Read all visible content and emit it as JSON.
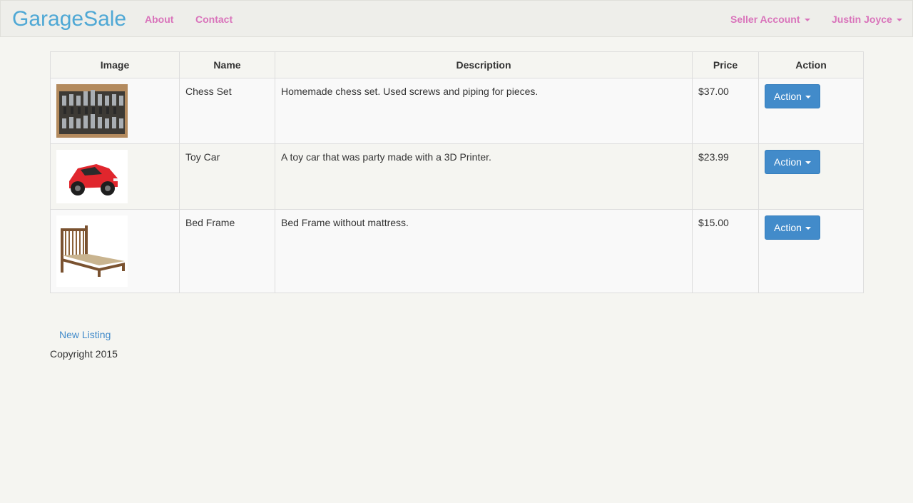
{
  "nav": {
    "brand": "GarageSale",
    "about": "About",
    "contact": "Contact",
    "seller_account": "Seller Account",
    "user": "Justin Joyce"
  },
  "table": {
    "headers": [
      "Image",
      "Name",
      "Description",
      "Price",
      "Action"
    ],
    "rows": [
      {
        "image_icon": "chess-set-image",
        "name": "Chess Set",
        "description": "Homemade chess set. Used screws and piping for pieces.",
        "price": "$37.00",
        "action": "Action"
      },
      {
        "image_icon": "toy-car-image",
        "name": "Toy Car",
        "description": "A toy car that was party made with a 3D Printer.",
        "price": "$23.99",
        "action": "Action"
      },
      {
        "image_icon": "bed-frame-image",
        "name": "Bed Frame",
        "description": "Bed Frame without mattress.",
        "price": "$15.00",
        "action": "Action"
      }
    ]
  },
  "footer": {
    "new_listing": "New Listing",
    "copyright": "Copyright 2015"
  },
  "colors": {
    "brand": "#4fa8d5",
    "nav_link": "#d974bb",
    "primary_button": "#428bca",
    "background": "#f5f5f1"
  }
}
